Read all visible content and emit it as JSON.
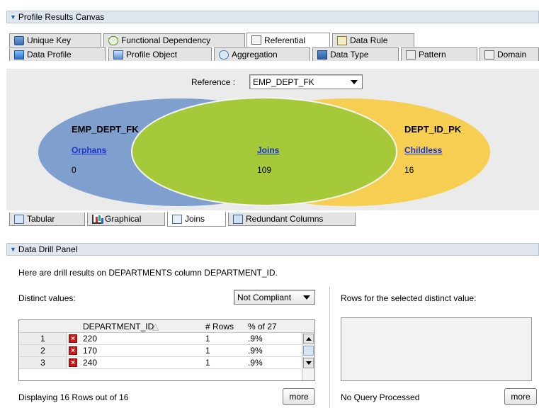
{
  "profile_panel": {
    "title": "Profile Results Canvas"
  },
  "top_tabs_row1": [
    {
      "label": "Unique Key",
      "icon": "unique-key-icon"
    },
    {
      "label": "Functional Dependency",
      "icon": "functional-dependency-icon"
    },
    {
      "label": "Referential",
      "icon": "referential-icon"
    },
    {
      "label": "Data Rule",
      "icon": "data-rule-icon"
    }
  ],
  "top_tabs_row2": [
    {
      "label": "Data Profile",
      "icon": "data-profile-icon"
    },
    {
      "label": "Profile Object",
      "icon": "profile-object-icon"
    },
    {
      "label": "Aggregation",
      "icon": "aggregation-icon"
    },
    {
      "label": "Data Type",
      "icon": "data-type-icon"
    },
    {
      "label": "Pattern",
      "icon": "pattern-icon"
    },
    {
      "label": "Domain",
      "icon": "domain-icon"
    }
  ],
  "reference": {
    "label": "Reference :",
    "value": "EMP_DEPT_FK"
  },
  "venn": {
    "left": {
      "title": "EMP_DEPT_FK",
      "link": "Orphans",
      "value": "0"
    },
    "middle": {
      "link": "Joins",
      "value": "109"
    },
    "right": {
      "title": "DEPT_ID_PK",
      "link": "Childless",
      "value": "16"
    },
    "colors": {
      "left": "#7f9fcf",
      "right": "#f6cf52",
      "middle": "#a6c93a"
    }
  },
  "bottom_tabs": [
    {
      "label": "Tabular",
      "icon": "table-icon"
    },
    {
      "label": "Graphical",
      "icon": "bar-chart-icon"
    },
    {
      "label": "Joins",
      "icon": "joins-icon"
    },
    {
      "label": "Redundant Columns",
      "icon": "redundant-columns-icon"
    }
  ],
  "drill_panel": {
    "title": "Data Drill Panel",
    "description": "Here are drill results on DEPARTMENTS column DEPARTMENT_ID.",
    "distinct_label": "Distinct values:",
    "filter_value": "Not Compliant",
    "rows_label": "Rows for the selected distinct value:",
    "columns": [
      "DEPARTMENT_ID",
      "# Rows",
      "% of 27"
    ],
    "rows": [
      {
        "num": "1",
        "id": "220",
        "count": "1",
        "pct": ".9%"
      },
      {
        "num": "2",
        "id": "170",
        "count": "1",
        "pct": ".9%"
      },
      {
        "num": "3",
        "id": "240",
        "count": "1",
        "pct": ".9%"
      }
    ],
    "status_left": "Displaying 16 Rows out of 16",
    "more_left": "more",
    "status_right": "No Query Processed",
    "more_right": "more"
  }
}
